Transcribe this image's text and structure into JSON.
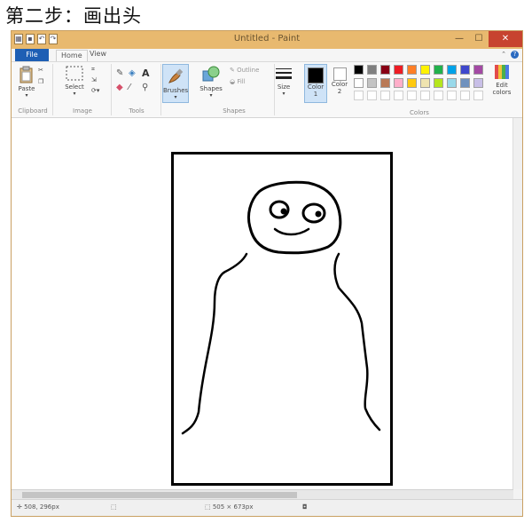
{
  "heading": "第二步：画出头",
  "window": {
    "title": "Untitled - Paint",
    "controls": [
      "—",
      "☐",
      "✕"
    ]
  },
  "menu": {
    "file": "File",
    "tabs": [
      "Home",
      "View"
    ]
  },
  "ribbon": {
    "groups": {
      "clipboard": {
        "label": "Clipboard",
        "paste": "Paste"
      },
      "image": {
        "label": "Image",
        "select": "Select"
      },
      "tools": {
        "label": "Tools"
      },
      "brushes": {
        "label": "Brushes"
      },
      "shapes": {
        "label": "Shapes",
        "outline": "Outline",
        "fill": "Fill"
      },
      "size": {
        "label": "Size"
      },
      "color1": {
        "label": "Color 1"
      },
      "color2": {
        "label": "Color 2"
      },
      "colors": {
        "label": "Colors",
        "edit": "Edit colors"
      }
    },
    "palette_top": [
      "#000000",
      "#7f7f7f",
      "#880015",
      "#ed1c24",
      "#ff7f27",
      "#fff200",
      "#22b14c",
      "#00a2e8",
      "#3f48cc",
      "#a349a4"
    ],
    "palette_bottom": [
      "#ffffff",
      "#c3c3c3",
      "#b97a57",
      "#ffaec9",
      "#ffc90e",
      "#efe4b0",
      "#b5e61d",
      "#99d9ea",
      "#7092be",
      "#c8bfe7"
    ],
    "color1_value": "#000000",
    "color2_value": "#ffffff"
  },
  "status": {
    "cursor": "508, 296px",
    "dimensions": "505 × 673px"
  }
}
